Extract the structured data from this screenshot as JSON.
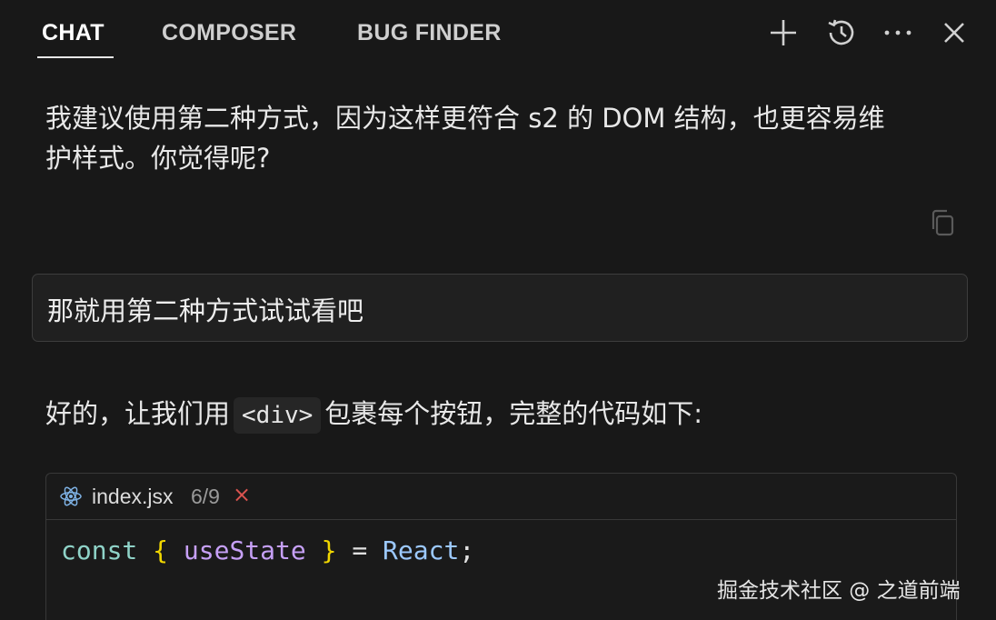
{
  "tabs": [
    {
      "label": "CHAT",
      "active": true
    },
    {
      "label": "COMPOSER",
      "active": false
    },
    {
      "label": "BUG FINDER",
      "active": false
    }
  ],
  "toolbar": {
    "icons": [
      "plus-icon",
      "history-icon",
      "more-icon",
      "close-icon"
    ]
  },
  "messages": {
    "assistant_1": {
      "line1": "我建议使用第二种方式，因为这样更符合 s2 的 DOM 结构，也更容易维",
      "line2": "护样式。你觉得呢?"
    },
    "user_1": "那就用第二种方式试试看吧",
    "assistant_2": {
      "before": "好的，让我们用",
      "code": "<div>",
      "after": "包裹每个按钮，完整的代码如下:"
    }
  },
  "code_block": {
    "file_name": "index.jsx",
    "file_count": "6/9",
    "close_symbol": "×",
    "line1": {
      "kw": "const",
      "open": "{",
      "var": "useState",
      "close": "}",
      "op": "=",
      "cls": "React",
      "end": ";"
    }
  },
  "watermark": "掘金技术社区 @ 之道前端",
  "colors": {
    "background": "#181818",
    "keyword": "#8fd3c8",
    "brace": "#f1d700",
    "variable": "#c6a0f6",
    "class": "#9cc9ff",
    "close_red": "#d9534f"
  }
}
